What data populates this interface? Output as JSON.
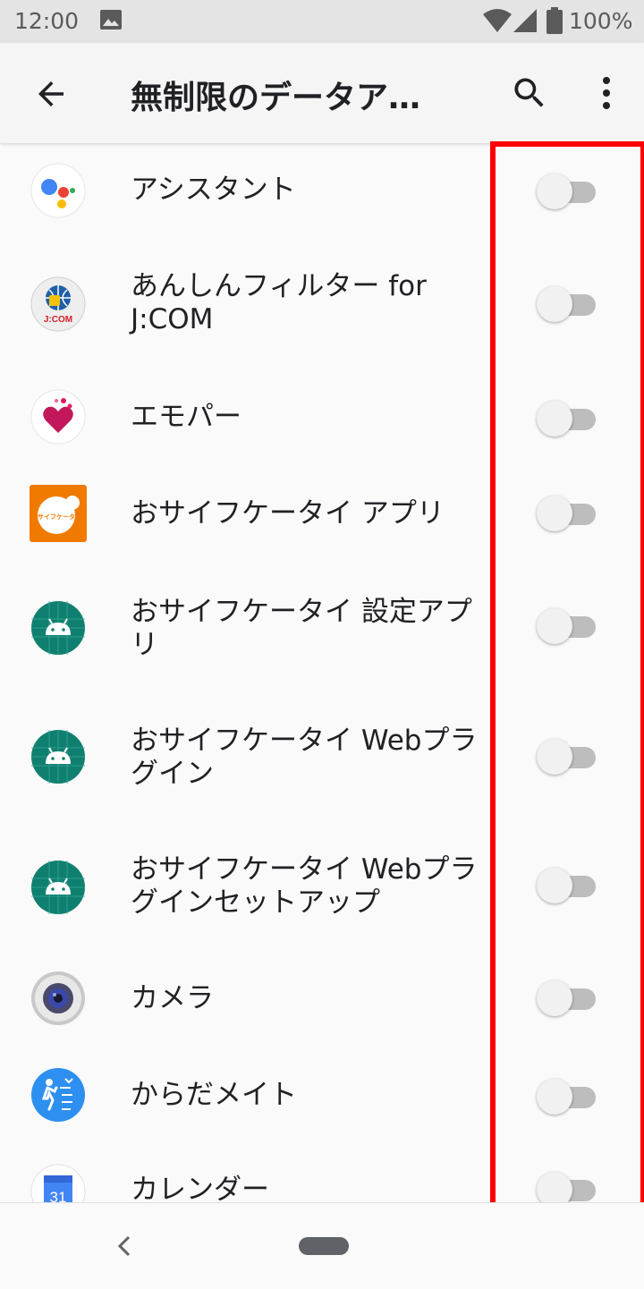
{
  "status_bar": {
    "time": "12:00",
    "battery_percent": "100%",
    "icons": [
      "image-icon",
      "wifi-icon",
      "signal-icon",
      "battery-icon"
    ]
  },
  "app_bar": {
    "title": "無制限のデータア…",
    "icons": [
      "back-arrow-icon",
      "search-icon",
      "more-vert-icon"
    ]
  },
  "apps": [
    {
      "name": "アシスタント",
      "icon": "google-assistant-icon",
      "enabled": false
    },
    {
      "name": "あんしんフィルター for J:COM",
      "icon": "anshin-filter-icon",
      "icon_text": "J:COM",
      "enabled": false
    },
    {
      "name": "エモパー",
      "icon": "emopa-heart-icon",
      "enabled": false
    },
    {
      "name": "おサイフケータイ アプリ",
      "icon": "osaifu-keitai-icon",
      "icon_text": "おサイフケータイ",
      "enabled": false
    },
    {
      "name": "おサイフケータイ 設定アプリ",
      "icon": "android-icon",
      "enabled": false
    },
    {
      "name": "おサイフケータイ Webプラグイン",
      "icon": "android-icon",
      "enabled": false
    },
    {
      "name": "おサイフケータイ Webプラグインセットアップ",
      "icon": "android-icon",
      "enabled": false
    },
    {
      "name": "カメラ",
      "icon": "camera-icon",
      "enabled": false
    },
    {
      "name": "からだメイト",
      "icon": "karada-mate-icon",
      "enabled": false
    },
    {
      "name": "カレンダー",
      "icon": "calendar-icon",
      "icon_text": "31",
      "enabled": false
    }
  ],
  "colors": {
    "highlight": "#ff0000",
    "android_icon_bg": "#0f8070",
    "osaifu_bg": "#f07a00",
    "toggle_track_off": "#bdbdbd",
    "status_bar_bg": "#e4e4e4"
  },
  "nav_bar": {
    "icons": [
      "nav-back-icon",
      "home-pill"
    ]
  }
}
